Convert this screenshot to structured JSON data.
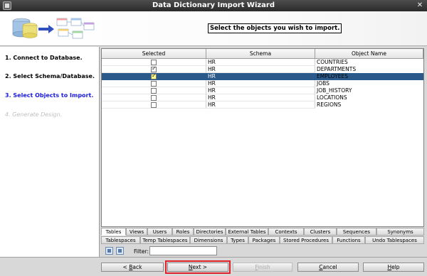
{
  "window": {
    "title": "Data Dictionary Import Wizard"
  },
  "banner": {
    "instruction": "Select the objects you wish to import."
  },
  "steps": [
    {
      "label": "1. Connect to Database.",
      "state": "done"
    },
    {
      "label": "2. Select Schema/Database.",
      "state": "done"
    },
    {
      "label": "3. Select Objects to Import.",
      "state": "current"
    },
    {
      "label": "4. Generate Design.",
      "state": "pending"
    }
  ],
  "grid": {
    "columns": [
      "Selected",
      "Schema",
      "Object Name"
    ],
    "rows": [
      {
        "selected": false,
        "schema": "HR",
        "name": "COUNTRIES",
        "highlighted": false
      },
      {
        "selected": true,
        "schema": "HR",
        "name": "DEPARTMENTS",
        "highlighted": false
      },
      {
        "selected": true,
        "schema": "HR",
        "name": "EMPLOYEES",
        "highlighted": true
      },
      {
        "selected": false,
        "schema": "HR",
        "name": "JOBS",
        "highlighted": false
      },
      {
        "selected": false,
        "schema": "HR",
        "name": "JOB_HISTORY",
        "highlighted": false
      },
      {
        "selected": false,
        "schema": "HR",
        "name": "LOCATIONS",
        "highlighted": false
      },
      {
        "selected": false,
        "schema": "HR",
        "name": "REGIONS",
        "highlighted": false
      }
    ]
  },
  "tabs_row1": [
    "Tables",
    "Views",
    "Users",
    "Roles",
    "Directories",
    "External Tables",
    "Contexts",
    "Clusters",
    "Sequences",
    "Synonyms"
  ],
  "tabs_row2": [
    "Tablespaces",
    "Temp Tablespaces",
    "Dimensions",
    "Types",
    "Packages",
    "Stored Procedures",
    "Functions",
    "Undo Tablespaces"
  ],
  "filter": {
    "label": "Filter:",
    "value": ""
  },
  "buttons": {
    "back": {
      "pre": "< ",
      "mnemonic": "B",
      "post": "ack"
    },
    "next": {
      "pre": "",
      "mnemonic": "N",
      "post": "ext >"
    },
    "finish": {
      "pre": "",
      "mnemonic": "F",
      "post": "inish"
    },
    "cancel": {
      "pre": "",
      "mnemonic": "C",
      "post": "ancel"
    },
    "help": {
      "pre": "",
      "mnemonic": "H",
      "post": "elp"
    }
  },
  "colors": {
    "selection": "#2b5a8a",
    "current_step": "#1a1ae0",
    "focus_outline": "#e0202a"
  }
}
